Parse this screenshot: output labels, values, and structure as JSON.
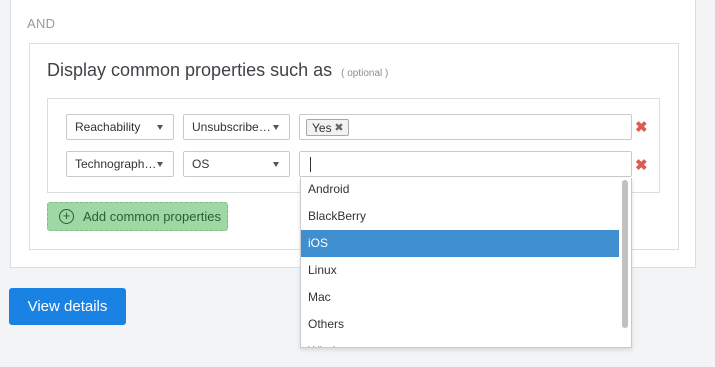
{
  "filter": {
    "and_label": "AND",
    "title": "Display common properties such as",
    "optional": "( optional )",
    "rows": [
      {
        "field": "Reachability",
        "operator": "Unsubscribe…",
        "value_tag": "Yes",
        "tag_remove": "✖",
        "remove": "✖"
      },
      {
        "field": "Technograph…",
        "operator": "OS",
        "value_tag": "",
        "tag_remove": "",
        "remove": "✖"
      }
    ],
    "add_button": {
      "icon": "+",
      "label": "Add common properties"
    }
  },
  "os_dropdown": {
    "options": [
      "Android",
      "BlackBerry",
      "iOS",
      "Linux",
      "Mac",
      "Others",
      "Windows"
    ],
    "selected": "iOS"
  },
  "view_details_button": "View details",
  "colors": {
    "accent": "#1a82e2",
    "selected_option": "#3e8ed0",
    "add_button_bg": "#9fd8a5",
    "remove": "#e05a4f"
  }
}
